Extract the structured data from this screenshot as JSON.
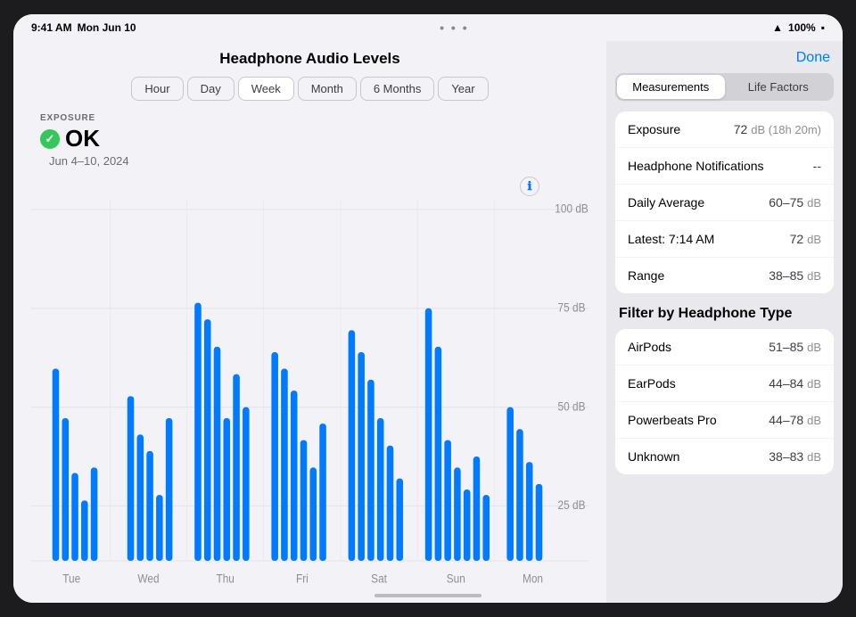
{
  "statusBar": {
    "time": "9:41 AM",
    "date": "Mon Jun 10",
    "wifi": "100%",
    "battery": "100%"
  },
  "page": {
    "title": "Headphone Audio Levels",
    "doneLabel": "Done"
  },
  "timePeriods": [
    "Hour",
    "Day",
    "Week",
    "6 Months",
    "Year"
  ],
  "activeTimePeriod": "Week",
  "exposure": {
    "label": "EXPOSURE",
    "status": "OK",
    "dateRange": "Jun 4–10, 2024"
  },
  "tabs": {
    "measurements": "Measurements",
    "lifeFactors": "Life Factors"
  },
  "activeTab": "Measurements",
  "metrics": [
    {
      "label": "Exposure",
      "value": "72",
      "unit": "dB (18h 20m)"
    },
    {
      "label": "Headphone Notifications",
      "value": "--",
      "unit": ""
    },
    {
      "label": "Daily Average",
      "value": "60–75",
      "unit": "dB"
    },
    {
      "label": "Latest: 7:14 AM",
      "value": "72",
      "unit": "dB"
    },
    {
      "label": "Range",
      "value": "38–85",
      "unit": "dB"
    }
  ],
  "filterTitle": "Filter by Headphone Type",
  "headphoneTypes": [
    {
      "label": "AirPods",
      "value": "51–85",
      "unit": "dB"
    },
    {
      "label": "EarPods",
      "value": "44–84",
      "unit": "dB"
    },
    {
      "label": "Powerbeats Pro",
      "value": "44–78",
      "unit": "dB"
    },
    {
      "label": "Unknown",
      "value": "38–83",
      "unit": "dB"
    }
  ],
  "chartDayLabels": [
    "Tue",
    "Wed",
    "Thu",
    "Fri",
    "Sat",
    "Sun",
    "Mon"
  ],
  "chartDbLabels": [
    "100 dB",
    "75 dB",
    "50 dB",
    "25 dB"
  ],
  "chartColors": {
    "bar": "#007aff",
    "grid": "#e5e5ea"
  }
}
